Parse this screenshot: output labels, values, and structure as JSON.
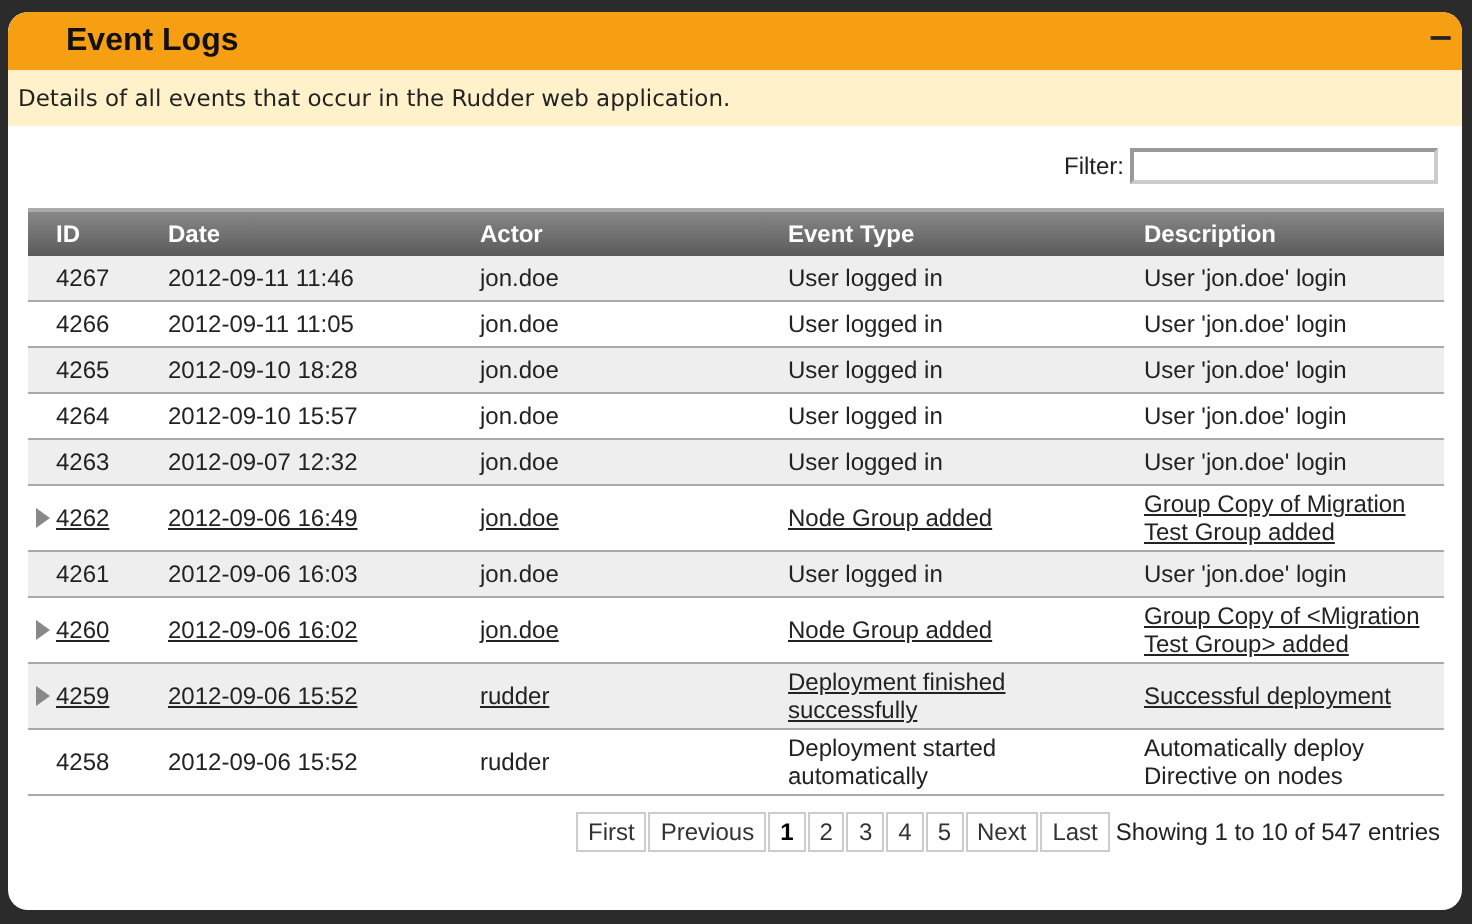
{
  "panel": {
    "title": "Event Logs",
    "collapse_button": "−",
    "description": "Details of all events that occur in the Rudder web application."
  },
  "filter": {
    "label": "Filter:"
  },
  "table": {
    "columns": [
      "ID",
      "Date",
      "Actor",
      "Event Type",
      "Description"
    ],
    "rows": [
      {
        "expandable": false,
        "cells": [
          "4267",
          "2012-09-11 11:46",
          "jon.doe",
          "User logged in",
          "User 'jon.doe' login"
        ]
      },
      {
        "expandable": false,
        "cells": [
          "4266",
          "2012-09-11 11:05",
          "jon.doe",
          "User logged in",
          "User 'jon.doe' login"
        ]
      },
      {
        "expandable": false,
        "cells": [
          "4265",
          "2012-09-10 18:28",
          "jon.doe",
          "User logged in",
          "User 'jon.doe' login"
        ]
      },
      {
        "expandable": false,
        "cells": [
          "4264",
          "2012-09-10 15:57",
          "jon.doe",
          "User logged in",
          "User 'jon.doe' login"
        ]
      },
      {
        "expandable": false,
        "cells": [
          "4263",
          "2012-09-07 12:32",
          "jon.doe",
          "User logged in",
          "User 'jon.doe' login"
        ]
      },
      {
        "expandable": true,
        "cells": [
          "4262",
          "2012-09-06 16:49",
          "jon.doe",
          "Node Group added",
          "Group Copy of Migration Test Group added"
        ]
      },
      {
        "expandable": false,
        "cells": [
          "4261",
          "2012-09-06 16:03",
          "jon.doe",
          "User logged in",
          "User 'jon.doe' login"
        ]
      },
      {
        "expandable": true,
        "cells": [
          "4260",
          "2012-09-06 16:02",
          "jon.doe",
          "Node Group added",
          "Group Copy of <Migration Test Group> added"
        ]
      },
      {
        "expandable": true,
        "cells": [
          "4259",
          "2012-09-06 15:52",
          "rudder",
          "Deployment finished successfully",
          "Successful deployment"
        ]
      },
      {
        "expandable": false,
        "cells": [
          "4258",
          "2012-09-06 15:52",
          "rudder",
          "Deployment started automatically",
          "Automatically deploy Directive on nodes"
        ]
      }
    ]
  },
  "pagination": {
    "buttons": [
      {
        "label": "First",
        "selected": false
      },
      {
        "label": "Previous",
        "selected": false
      },
      {
        "label": "1",
        "selected": true
      },
      {
        "label": "2",
        "selected": false
      },
      {
        "label": "3",
        "selected": false
      },
      {
        "label": "4",
        "selected": false
      },
      {
        "label": "5",
        "selected": false
      },
      {
        "label": "Next",
        "selected": false
      },
      {
        "label": "Last",
        "selected": false
      }
    ],
    "info": "Showing 1 to 10 of 547 entries"
  }
}
